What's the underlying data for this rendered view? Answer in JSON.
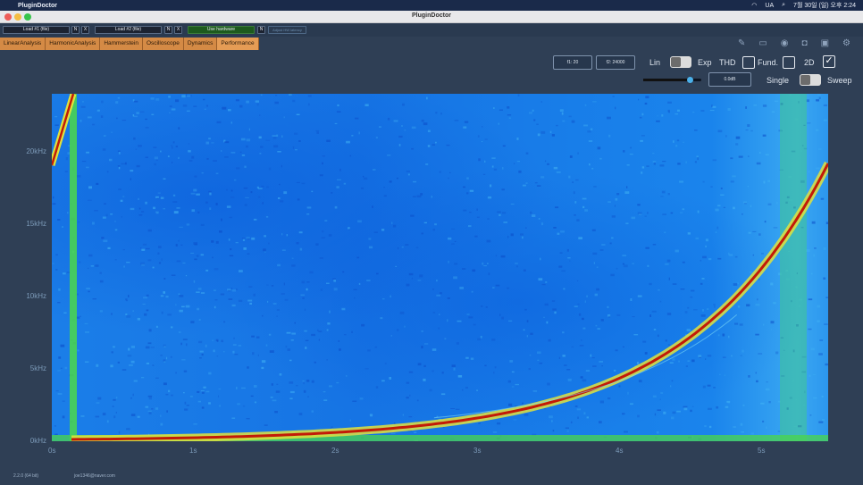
{
  "menubar": {
    "app_name": "PluginDoctor",
    "date_time": "7월 30일 (일) 오후 2:24",
    "lang": "UA"
  },
  "window": {
    "title": "PluginDoctor"
  },
  "toolbar": {
    "load1": "Load #1 (file)",
    "load2": "Load #2 (file)",
    "n": "N",
    "x": "X",
    "use_hardware": "Use hardware",
    "adjust_latency": "Adjust HW latency"
  },
  "tabs": [
    "LinearAnalysis",
    "HarmonicAnalysis",
    "Hammerstein",
    "Oscilloscope",
    "Dynamics",
    "Performance"
  ],
  "controls": {
    "f1": "f1: 20",
    "f2": "f2: 24000",
    "lin": "Lin",
    "exp": "Exp",
    "thd": "THD",
    "fund": "Fund.",
    "two_d": "2D",
    "gain": "0.0dB",
    "single": "Single",
    "sweep": "Sweep",
    "two_d_checked": true,
    "gain_slider_fraction": 0.8
  },
  "plot": {
    "y_ticks": [
      "20kHz",
      "15kHz",
      "10kHz",
      "5kHz",
      "0kHz"
    ],
    "x_ticks": [
      "0s",
      "1s",
      "2s",
      "3s",
      "4s",
      "5s"
    ],
    "colors": {
      "sweep": "#c21a08",
      "noise": "#1a7ce8",
      "hot": "#47d63a"
    }
  },
  "footer": {
    "version": "2.2.0 (64 bit)",
    "email": "joe1346@naver.com"
  }
}
